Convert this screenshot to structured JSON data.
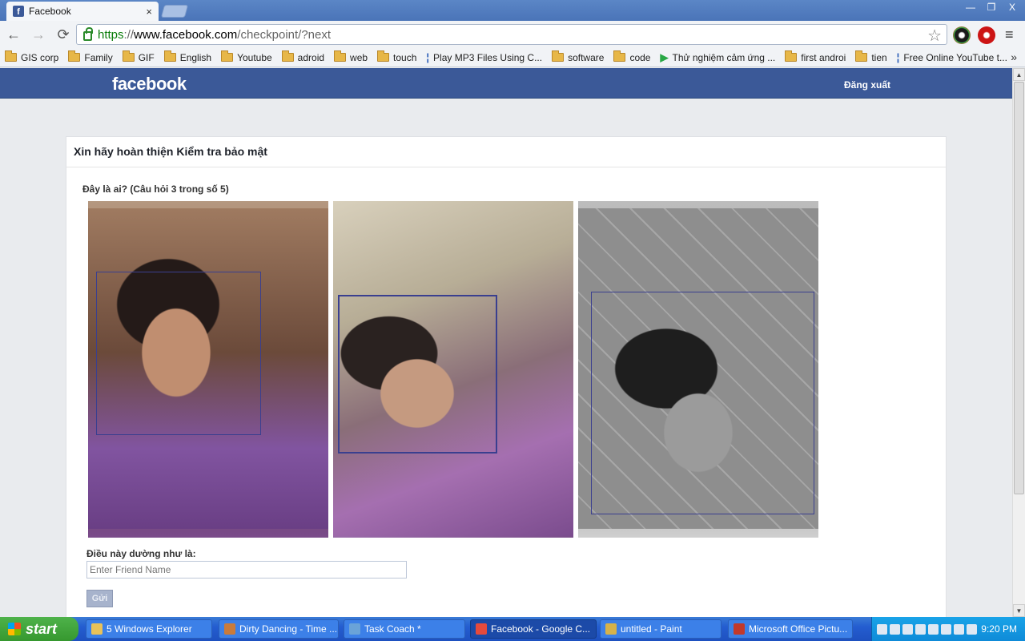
{
  "browser": {
    "tab_title": "Facebook",
    "tab_close": "×",
    "window_controls": [
      "—",
      "❐",
      "X"
    ],
    "nav": {
      "back": "←",
      "forward": "→",
      "reload": "⟳"
    },
    "url": {
      "scheme": "https",
      "separator": "://",
      "host": "www.facebook.com",
      "path": "/checkpoint/?next"
    },
    "star": "☆",
    "menu": "≡",
    "bookmarks": [
      {
        "label": "GIS corp",
        "icon": "folder-icon"
      },
      {
        "label": "Family",
        "icon": "folder-icon"
      },
      {
        "label": "GIF",
        "icon": "folder-icon"
      },
      {
        "label": "English",
        "icon": "folder-icon"
      },
      {
        "label": "Youtube",
        "icon": "folder-icon"
      },
      {
        "label": "adroid",
        "icon": "folder-icon"
      },
      {
        "label": "web",
        "icon": "folder-icon"
      },
      {
        "label": "touch",
        "icon": "folder-icon"
      },
      {
        "label": "Play MP3 Files Using C...",
        "icon": "link-icon"
      },
      {
        "label": "software",
        "icon": "folder-icon"
      },
      {
        "label": "code",
        "icon": "folder-icon"
      },
      {
        "label": "Thử nghiệm cảm ứng ...",
        "icon": "play-icon"
      },
      {
        "label": "first androi",
        "icon": "folder-icon"
      },
      {
        "label": "tien",
        "icon": "folder-icon"
      },
      {
        "label": "Free Online YouTube t...",
        "icon": "link-icon"
      }
    ],
    "bookmarks_more": "»"
  },
  "facebook": {
    "logo": "facebook",
    "logout": "Đăng xuất",
    "card_title": "Xin hãy hoàn thiện Kiểm tra bảo mật",
    "question": "Đây là ai? (Câu hỏi 3 trong số 5)",
    "answer_label": "Điều này dường như là:",
    "friend_placeholder": "Enter Friend Name",
    "submit_label": "Gửi"
  },
  "taskbar": {
    "start": "start",
    "items": [
      {
        "label": "5 Windows Explorer",
        "color": "#e9c259",
        "active": false
      },
      {
        "label": "Dirty Dancing - Time ...",
        "color": "#c97b3b",
        "active": false
      },
      {
        "label": "Task Coach *",
        "color": "#6aa3d8",
        "active": false
      },
      {
        "label": "Facebook - Google C...",
        "color": "#e64a3c",
        "active": true
      },
      {
        "label": "untitled - Paint",
        "color": "#d6b24a",
        "active": false
      },
      {
        "label": "Microsoft Office Pictu...",
        "color": "#c2392b",
        "active": false
      }
    ],
    "clock": "9:20 PM"
  },
  "colors": {
    "facebook_blue": "#3b5998",
    "face_box": "#3a3f8f",
    "taskbar_blue": "#245dd0",
    "start_green": "#3ea63a"
  }
}
